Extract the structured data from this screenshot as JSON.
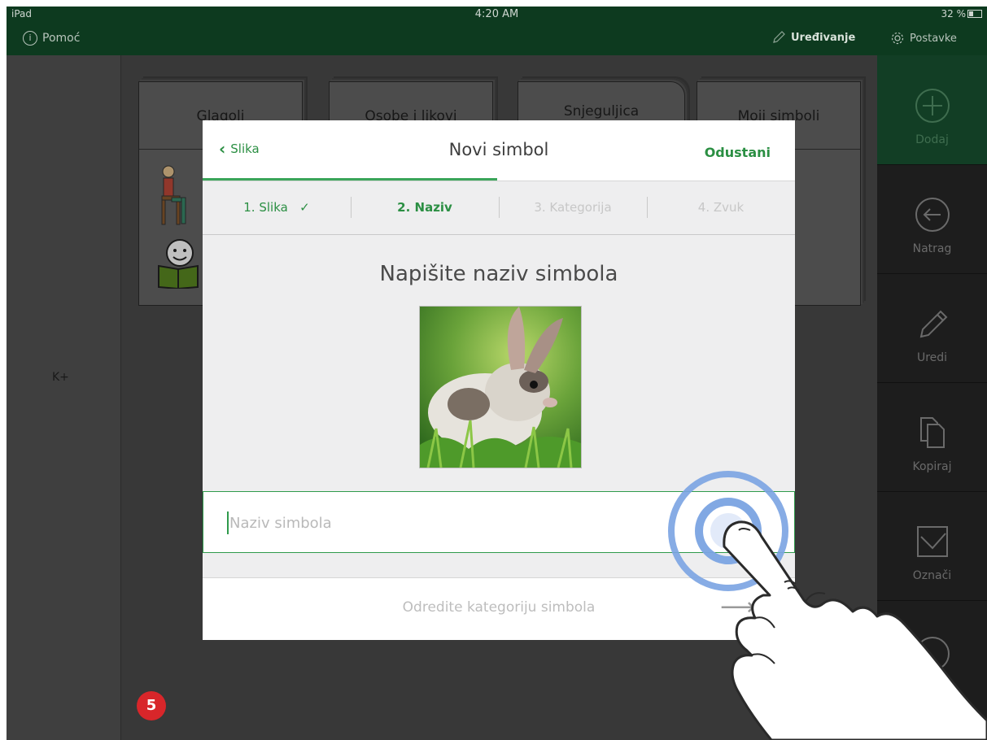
{
  "status_bar": {
    "device": "iPad",
    "time": "4:20 AM",
    "battery": "32 %",
    "help_label": "Pomoć",
    "edit_label": "Uređivanje",
    "settings_label": "Postavke"
  },
  "background": {
    "cards": [
      {
        "title": "Glagoli"
      },
      {
        "title": "Osobe i likovi"
      },
      {
        "title": "Snjeguljica"
      },
      {
        "title": "Moji simboli"
      }
    ],
    "left_label": "K+",
    "step_badge": "5"
  },
  "sidebar": {
    "items": [
      {
        "label": "Dodaj",
        "icon": "plus-circle-icon"
      },
      {
        "label": "Natrag",
        "icon": "back-arrow-circle-icon"
      },
      {
        "label": "Uredi",
        "icon": "pencil-icon"
      },
      {
        "label": "Kopiraj",
        "icon": "copy-icon"
      },
      {
        "label": "Označi",
        "icon": "checkbox-icon"
      }
    ]
  },
  "modal": {
    "back_label": "Slika",
    "title": "Novi simbol",
    "cancel_label": "Odustani",
    "steps": [
      {
        "label": "1. Slika",
        "state": "done"
      },
      {
        "label": "2. Naziv",
        "state": "active"
      },
      {
        "label": "3. Kategorija",
        "state": "pending"
      },
      {
        "label": "4. Zvuk",
        "state": "pending"
      }
    ],
    "heading": "Napišite naziv simbola",
    "name_input": {
      "value": "",
      "placeholder": "Naziv simbola"
    },
    "next_label": "Odredite kategoriju simbola"
  },
  "colors": {
    "accent": "#2b8f43",
    "status_bar": "#0d3a1f",
    "tap_ring": "#7aa3e2",
    "badge": "#d8262a"
  }
}
